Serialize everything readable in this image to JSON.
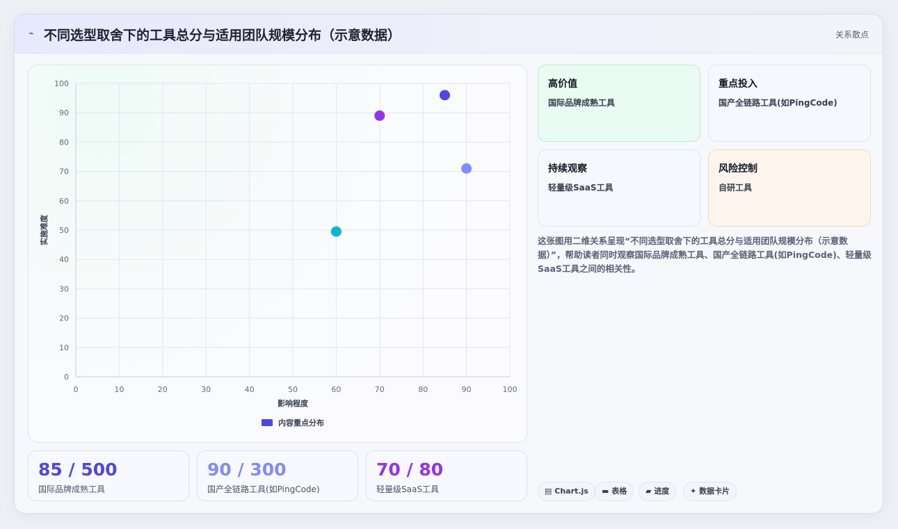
{
  "header": {
    "icon": "lightning-icon",
    "title": "不同选型取舍下的工具总分与适用团队规模分布（示意数据）",
    "tag": "关系散点"
  },
  "chart_data": {
    "type": "scatter",
    "title": "",
    "xlabel": "影响程度",
    "ylabel": "实施难度",
    "xlim": [
      0,
      100
    ],
    "ylim": [
      0,
      100
    ],
    "xticks": [
      "0",
      "10",
      "20",
      "30",
      "40",
      "50",
      "60",
      "70",
      "80",
      "90",
      "100"
    ],
    "yticks": [
      "0",
      "10",
      "20",
      "30",
      "40",
      "50",
      "60",
      "70",
      "80",
      "90",
      "100"
    ],
    "grid": true,
    "legend_position": "bottom",
    "series": [
      {
        "name": "内容重点分布",
        "legend_color": "#4f46e5",
        "points": [
          {
            "x": 85,
            "y": 96,
            "color": "#4f46e5"
          },
          {
            "x": 70,
            "y": 89,
            "color": "#9333ea"
          },
          {
            "x": 90,
            "y": 71,
            "color": "#818cf8"
          },
          {
            "x": 60,
            "y": 49.5,
            "color": "#06b6d4"
          }
        ]
      }
    ]
  },
  "stats": [
    {
      "value": "85 / 500",
      "label": "国际品牌成熟工具",
      "color": "#4f46e5"
    },
    {
      "value": "90 / 300",
      "label": "国产全链路工具(如PingCode)",
      "color": "#818cf8"
    },
    {
      "value": "70 / 80",
      "label": "轻量级SaaS工具",
      "color": "#9333ea"
    }
  ],
  "quadrants": [
    {
      "title": "高价值",
      "subtitle": "国际品牌成熟工具",
      "bg": "#e9fbf3",
      "border": "#b5ecd3"
    },
    {
      "title": "重点投入",
      "subtitle": "国产全链路工具(如PingCode)",
      "bg": "#f7f8fd",
      "border": "#dde3f3"
    },
    {
      "title": "持续观察",
      "subtitle": "轻量级SaaS工具",
      "bg": "#f7f8fd",
      "border": "#dde3f3"
    },
    {
      "title": "风险控制",
      "subtitle": "自研工具",
      "bg": "#fdf5ec",
      "border": "#f3d8b8"
    }
  ],
  "description": "这张图用二维关系呈现“不同选型取舍下的工具总分与适用团队规模分布（示意数据）”，帮助读者同时观察国际品牌成熟工具、国产全链路工具(如PingCode)、轻量级SaaS工具之间的相关性。",
  "chips": [
    {
      "icon": "chart-icon",
      "glyph": "▤",
      "label": "Chart.js"
    },
    {
      "icon": "table-icon",
      "glyph": "▬",
      "label": "表格"
    },
    {
      "icon": "progress-icon",
      "glyph": "▰",
      "label": "进度"
    },
    {
      "icon": "sparkle-icon",
      "glyph": "✦",
      "label": "数据卡片"
    }
  ]
}
